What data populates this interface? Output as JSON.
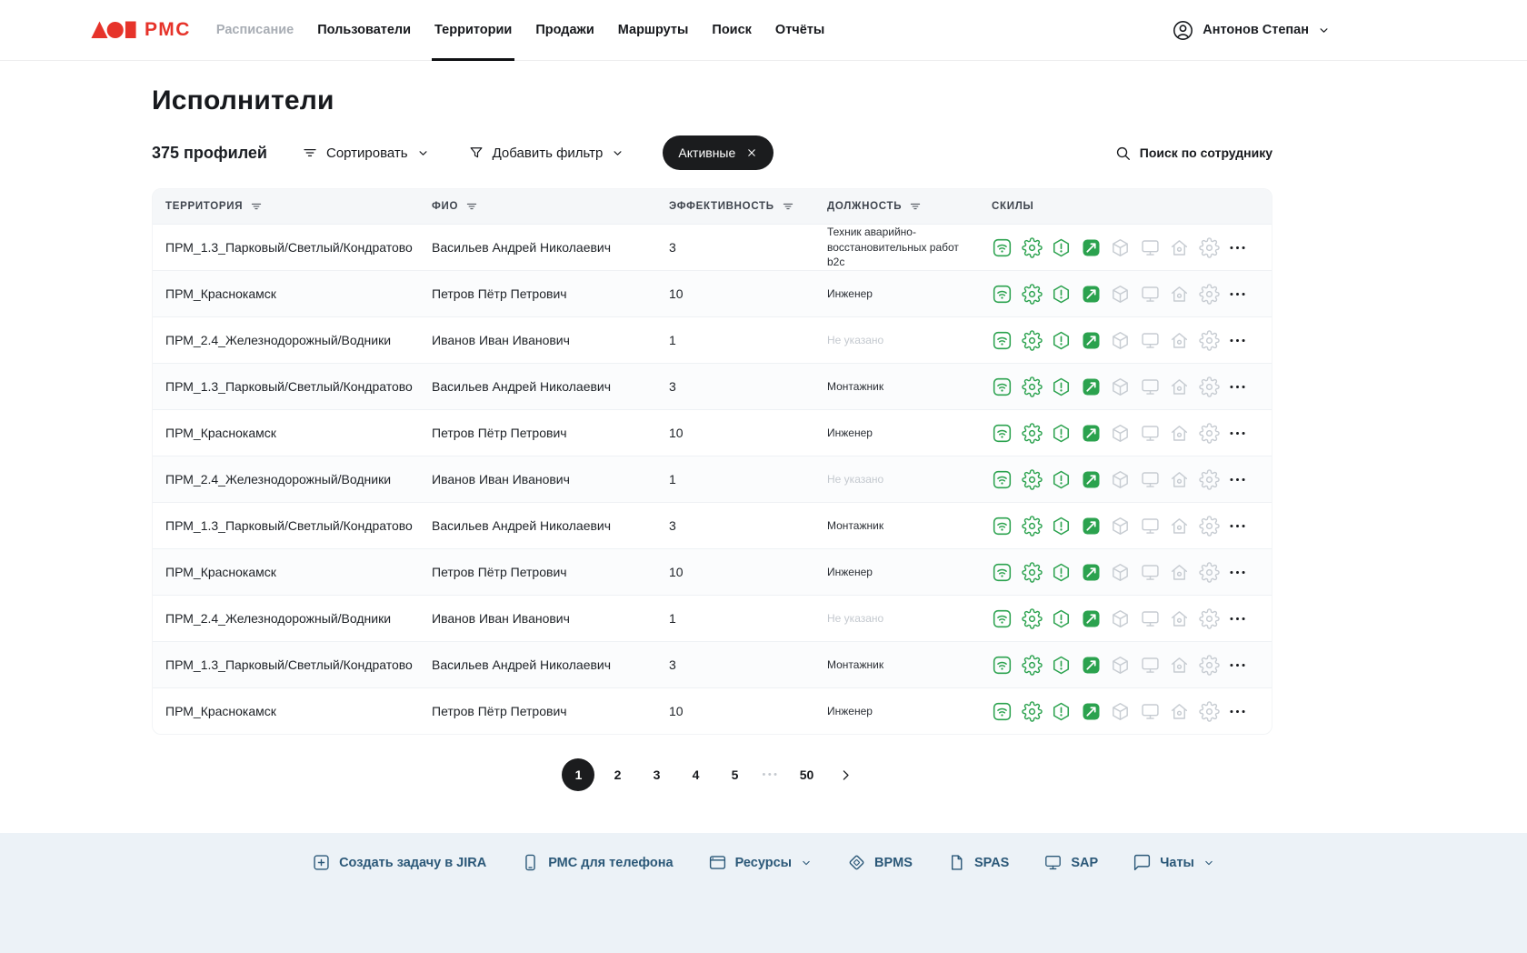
{
  "header": {
    "logo_text": "РМС",
    "nav_items": [
      {
        "label": "Расписание",
        "slug": "schedule",
        "state": "muted"
      },
      {
        "label": "Пользователи",
        "slug": "users",
        "state": "normal"
      },
      {
        "label": "Территории",
        "slug": "territories",
        "state": "active"
      },
      {
        "label": "Продажи",
        "slug": "sales",
        "state": "normal"
      },
      {
        "label": "Маршруты",
        "slug": "routes",
        "state": "normal"
      },
      {
        "label": "Поиск",
        "slug": "search",
        "state": "normal"
      },
      {
        "label": "Отчёты",
        "slug": "reports",
        "state": "normal"
      }
    ],
    "user_name": "Антонов Степан"
  },
  "page": {
    "title": "Исполнители",
    "profiles_count": "375 профилей",
    "sort_label": "Сортировать",
    "add_filter_label": "Добавить фильтр",
    "active_chip_label": "Активные",
    "search_label": "Поиск по сотруднику"
  },
  "table": {
    "columns": [
      {
        "label": "ТЕРРИТОРИЯ",
        "filter": true
      },
      {
        "label": "ФИО",
        "filter": true
      },
      {
        "label": "ЭФФЕКТИВНОСТЬ",
        "filter": true
      },
      {
        "label": "ДОЛЖНОСТЬ",
        "filter": true
      },
      {
        "label": "СКИЛЫ",
        "filter": false
      }
    ],
    "skills_icons": [
      {
        "name": "wifi-icon",
        "symbol": "wifi",
        "active": true
      },
      {
        "name": "gear-icon",
        "symbol": "gear",
        "active": true
      },
      {
        "name": "warning-icon",
        "symbol": "warning",
        "active": true
      },
      {
        "name": "meter-icon",
        "symbol": "meter",
        "active": true
      },
      {
        "name": "cube-icon",
        "symbol": "cube",
        "active": false
      },
      {
        "name": "monitor-icon",
        "symbol": "monitor",
        "active": false
      },
      {
        "name": "home-icon",
        "symbol": "home",
        "active": false
      },
      {
        "name": "settings-icon",
        "symbol": "settings",
        "active": false
      }
    ],
    "rows": [
      {
        "territory": "ПРМ_1.3_Парковый/Светлый/Кондратово",
        "fio": "Васильев Андрей Николаевич",
        "efficiency": "3",
        "position": "Техник аварийно-восстановительных работ b2c",
        "position_empty": false
      },
      {
        "territory": "ПРМ_Краснокамск",
        "fio": "Петров Пётр Петрович",
        "efficiency": "10",
        "position": "Инженер",
        "position_empty": false
      },
      {
        "territory": "ПРМ_2.4_Железнодорожный/Водники",
        "fio": "Иванов Иван Иванович",
        "efficiency": "1",
        "position": "Не указано",
        "position_empty": true
      },
      {
        "territory": "ПРМ_1.3_Парковый/Светлый/Кондратово",
        "fio": "Васильев Андрей Николаевич",
        "efficiency": "3",
        "position": "Монтажник",
        "position_empty": false
      },
      {
        "territory": "ПРМ_Краснокамск",
        "fio": "Петров Пётр Петрович",
        "efficiency": "10",
        "position": "Инженер",
        "position_empty": false
      },
      {
        "territory": "ПРМ_2.4_Железнодорожный/Водники",
        "fio": "Иванов Иван Иванович",
        "efficiency": "1",
        "position": "Не указано",
        "position_empty": true
      },
      {
        "territory": "ПРМ_1.3_Парковый/Светлый/Кондратово",
        "fio": "Васильев Андрей Николаевич",
        "efficiency": "3",
        "position": "Монтажник",
        "position_empty": false
      },
      {
        "territory": "ПРМ_Краснокамск",
        "fio": "Петров Пётр Петрович",
        "efficiency": "10",
        "position": "Инженер",
        "position_empty": false
      },
      {
        "territory": "ПРМ_2.4_Железнодорожный/Водники",
        "fio": "Иванов Иван Иванович",
        "efficiency": "1",
        "position": "Не указано",
        "position_empty": true
      },
      {
        "territory": "ПРМ_1.3_Парковый/Светлый/Кондратово",
        "fio": "Васильев Андрей Николаевич",
        "efficiency": "3",
        "position": "Монтажник",
        "position_empty": false
      },
      {
        "territory": "ПРМ_Краснокамск",
        "fio": "Петров Пётр Петрович",
        "efficiency": "10",
        "position": "Инженер",
        "position_empty": false
      }
    ]
  },
  "pagination": {
    "pages": [
      "1",
      "2",
      "3",
      "4",
      "5"
    ],
    "current": "1",
    "ellipsis": "•••",
    "last_page": "50"
  },
  "footer": {
    "items": [
      {
        "label": "Создать задачу в JIRA",
        "icon": "jira-create-icon",
        "symbol": "jira",
        "chevron": false
      },
      {
        "label": "РМС для телефона",
        "icon": "phone-icon",
        "symbol": "phone",
        "chevron": false
      },
      {
        "label": "Ресурсы",
        "icon": "resources-icon",
        "symbol": "resources",
        "chevron": true
      },
      {
        "label": "BPMS",
        "icon": "bpms-icon",
        "symbol": "bpms",
        "chevron": false
      },
      {
        "label": "SPAS",
        "icon": "spas-icon",
        "symbol": "spas",
        "chevron": false
      },
      {
        "label": "SAP",
        "icon": "sap-icon",
        "symbol": "monitor",
        "chevron": false
      },
      {
        "label": "Чаты",
        "icon": "chats-icon",
        "symbol": "chat",
        "chevron": true
      }
    ]
  },
  "colors": {
    "accent_red": "#E6332A",
    "skill_green": "#2BA24E",
    "skill_gray": "#C7CCD2",
    "chip_dark": "#1B1C1E",
    "footer_text": "#2B5878",
    "footer_bg": "#ECF2F7"
  }
}
